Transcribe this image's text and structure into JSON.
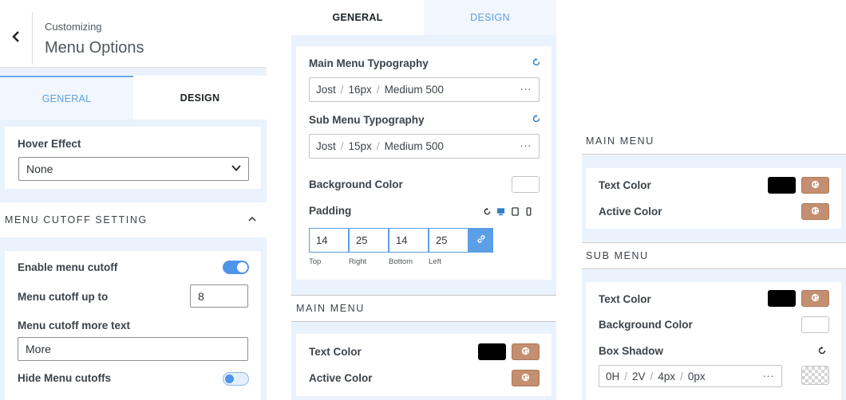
{
  "left": {
    "header": {
      "subtitle": "Customizing",
      "title": "Menu Options"
    },
    "tabs": {
      "general": "GENERAL",
      "design": "DESIGN"
    },
    "hover_effect": {
      "label": "Hover Effect",
      "value": "None"
    },
    "cutoff_section": {
      "title": "MENU CUTOFF SETTING"
    },
    "enable_cutoff": {
      "label": "Enable menu cutoff"
    },
    "cutoff_up_to": {
      "label": "Menu cutoff up to",
      "value": "8"
    },
    "cutoff_more_text": {
      "label": "Menu cutoff more text",
      "value": "More"
    },
    "hide_cutoffs": {
      "label": "Hide Menu cutoffs"
    }
  },
  "middle": {
    "tabs": {
      "general": "GENERAL",
      "design": "DESIGN"
    },
    "main_typo": {
      "label": "Main Menu Typography",
      "font": "Jost",
      "size": "16px",
      "weight": "Medium 500"
    },
    "sub_typo": {
      "label": "Sub Menu Typography",
      "font": "Jost",
      "size": "15px",
      "weight": "Medium 500"
    },
    "more_glyph": "···",
    "bg_color": {
      "label": "Background Color"
    },
    "padding": {
      "label": "Padding",
      "values": [
        "14",
        "25",
        "14",
        "25"
      ],
      "labels": [
        "Top",
        "Right",
        "Bottom",
        "Left"
      ]
    },
    "main_menu": {
      "title": "MAIN MENU",
      "text_color": "Text Color",
      "active_color": "Active Color"
    }
  },
  "right": {
    "main_menu": {
      "title": "MAIN MENU",
      "text_color": "Text Color",
      "active_color": "Active Color"
    },
    "sub_menu": {
      "title": "SUB MENU",
      "text_color": "Text Color",
      "bg_color": "Background Color",
      "box_shadow": {
        "label": "Box Shadow",
        "h": "0H",
        "v": "2V",
        "blur": "4px",
        "spread": "0px"
      }
    }
  },
  "colors": {
    "accent": "#4f94e8",
    "swatch_black": "#000000",
    "swatch_white": "#ffffff",
    "global_button": "#c48f70"
  }
}
